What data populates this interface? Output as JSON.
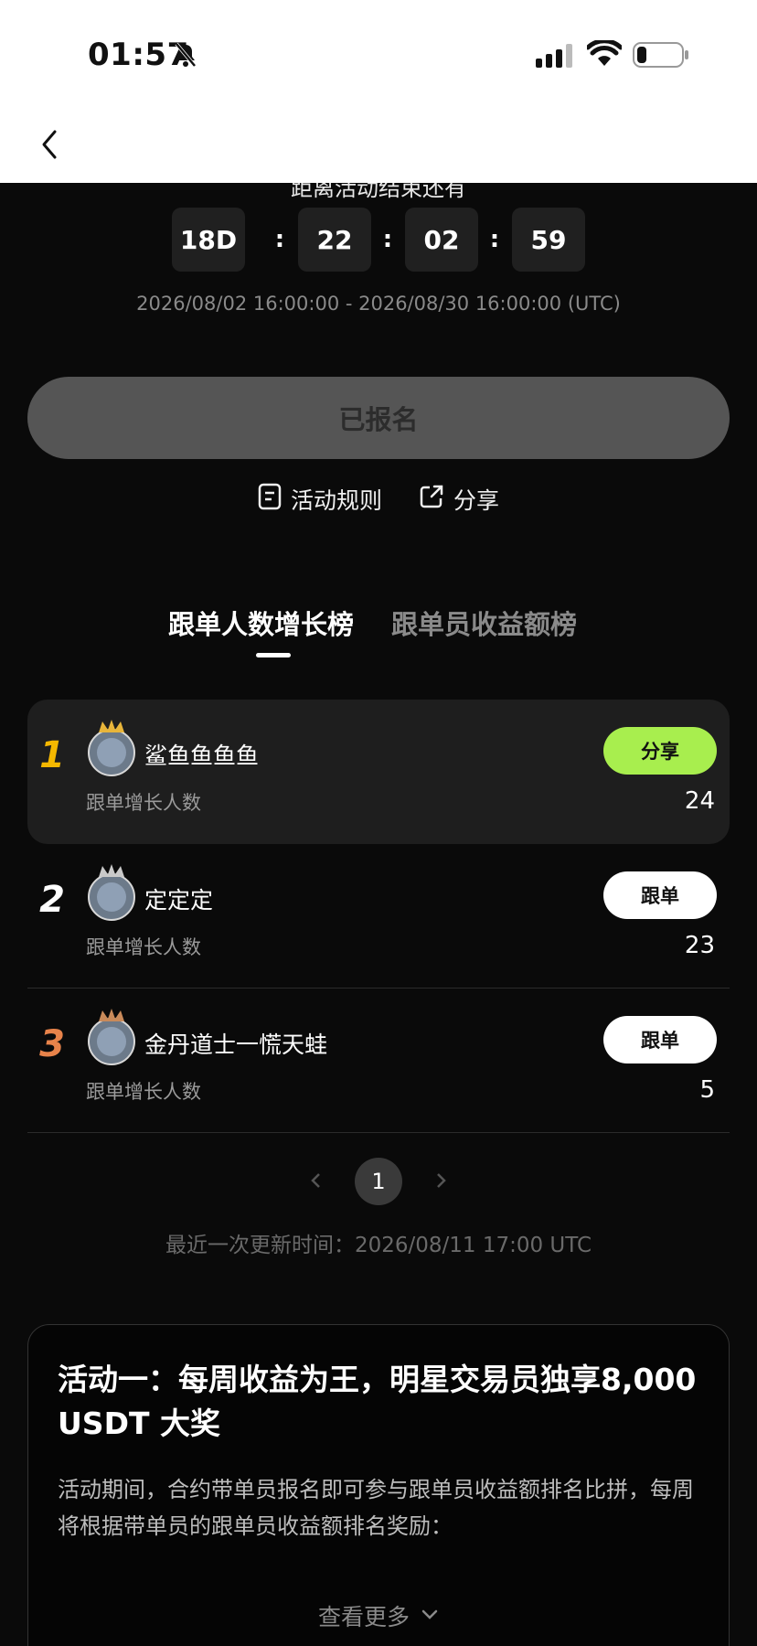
{
  "status_bar": {
    "time": "01:57"
  },
  "countdown": {
    "title": "距离活动结束还有",
    "days": "18D",
    "hours": "22",
    "minutes": "02",
    "seconds": "59",
    "separator": ":",
    "period": "2026/08/02 16:00:00 - 2026/08/30 16:00:00 (UTC)"
  },
  "signup": {
    "label": "已报名"
  },
  "links": {
    "rules": "活动规则",
    "share": "分享"
  },
  "tabs": [
    {
      "label": "跟单人数增长榜",
      "active": true
    },
    {
      "label": "跟单员收益额榜",
      "active": false
    }
  ],
  "leaderboard": [
    {
      "rank": "1",
      "rank_color": "#f5b800",
      "name": "鲨鱼鱼鱼鱼",
      "metric_label": "跟单增长人数",
      "value": "24",
      "button": "分享",
      "button_style": "green",
      "crown_color": "#e8b53a"
    },
    {
      "rank": "2",
      "rank_color": "#ffffff",
      "name": "定定定",
      "metric_label": "跟单增长人数",
      "value": "23",
      "button": "跟单",
      "button_style": "white",
      "crown_color": "#c9c9c9"
    },
    {
      "rank": "3",
      "rank_color": "#e8834a",
      "name": "金丹道士一慌天蛙",
      "metric_label": "跟单增长人数",
      "value": "5",
      "button": "跟单",
      "button_style": "white",
      "crown_color": "#c98a5a"
    }
  ],
  "pagination": {
    "current": "1"
  },
  "updated": "最近一次更新时间：2026/08/11 17:00 UTC",
  "activity_card": {
    "title": "活动一：每周收益为王，明星交易员独享8,000 USDT 大奖",
    "body": "活动期间，合约带单员报名即可参与跟单员收益额排名比拼，每周将根据带单员的跟单员收益额排名奖励：",
    "more": "查看更多"
  },
  "colors": {
    "accent_green": "#a8ee4e",
    "background": "#0a0a0a"
  },
  "icons": [
    "bell-slash-icon",
    "signal-icon",
    "wifi-icon",
    "battery-icon",
    "back-arrow-icon",
    "document-icon",
    "share-icon",
    "crown-icon",
    "chevron-left-icon",
    "chevron-right-icon",
    "chevron-down-icon"
  ]
}
